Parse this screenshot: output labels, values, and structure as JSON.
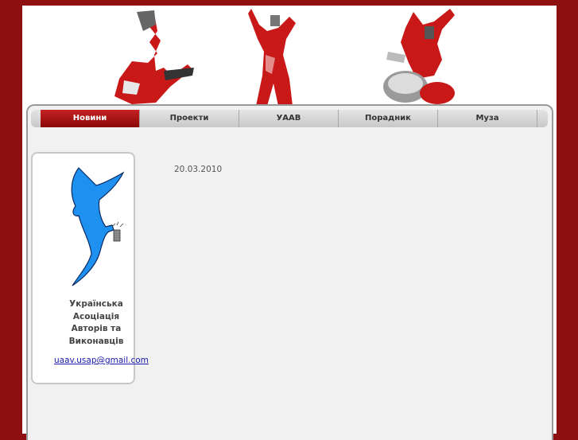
{
  "banner": {
    "figures": [
      "guitarist-figure",
      "singer-figure",
      "drummer-figure"
    ]
  },
  "nav": {
    "items": [
      {
        "label": "Новини"
      },
      {
        "label": "Проекти"
      },
      {
        "label": "УААВ"
      },
      {
        "label": "Порадник"
      },
      {
        "label": "Муза"
      }
    ],
    "active_index": 0
  },
  "sidebar": {
    "org_lines": [
      "Українська",
      "Асоціація",
      "Авторів та",
      "Виконавців"
    ],
    "email": "uaav.usap@gmail.com"
  },
  "main": {
    "date": "20.03.2010"
  },
  "colors": {
    "background": "#8e1010",
    "accent": "#b81818",
    "logo": "#1e90f0",
    "link": "#1a1aa8"
  }
}
